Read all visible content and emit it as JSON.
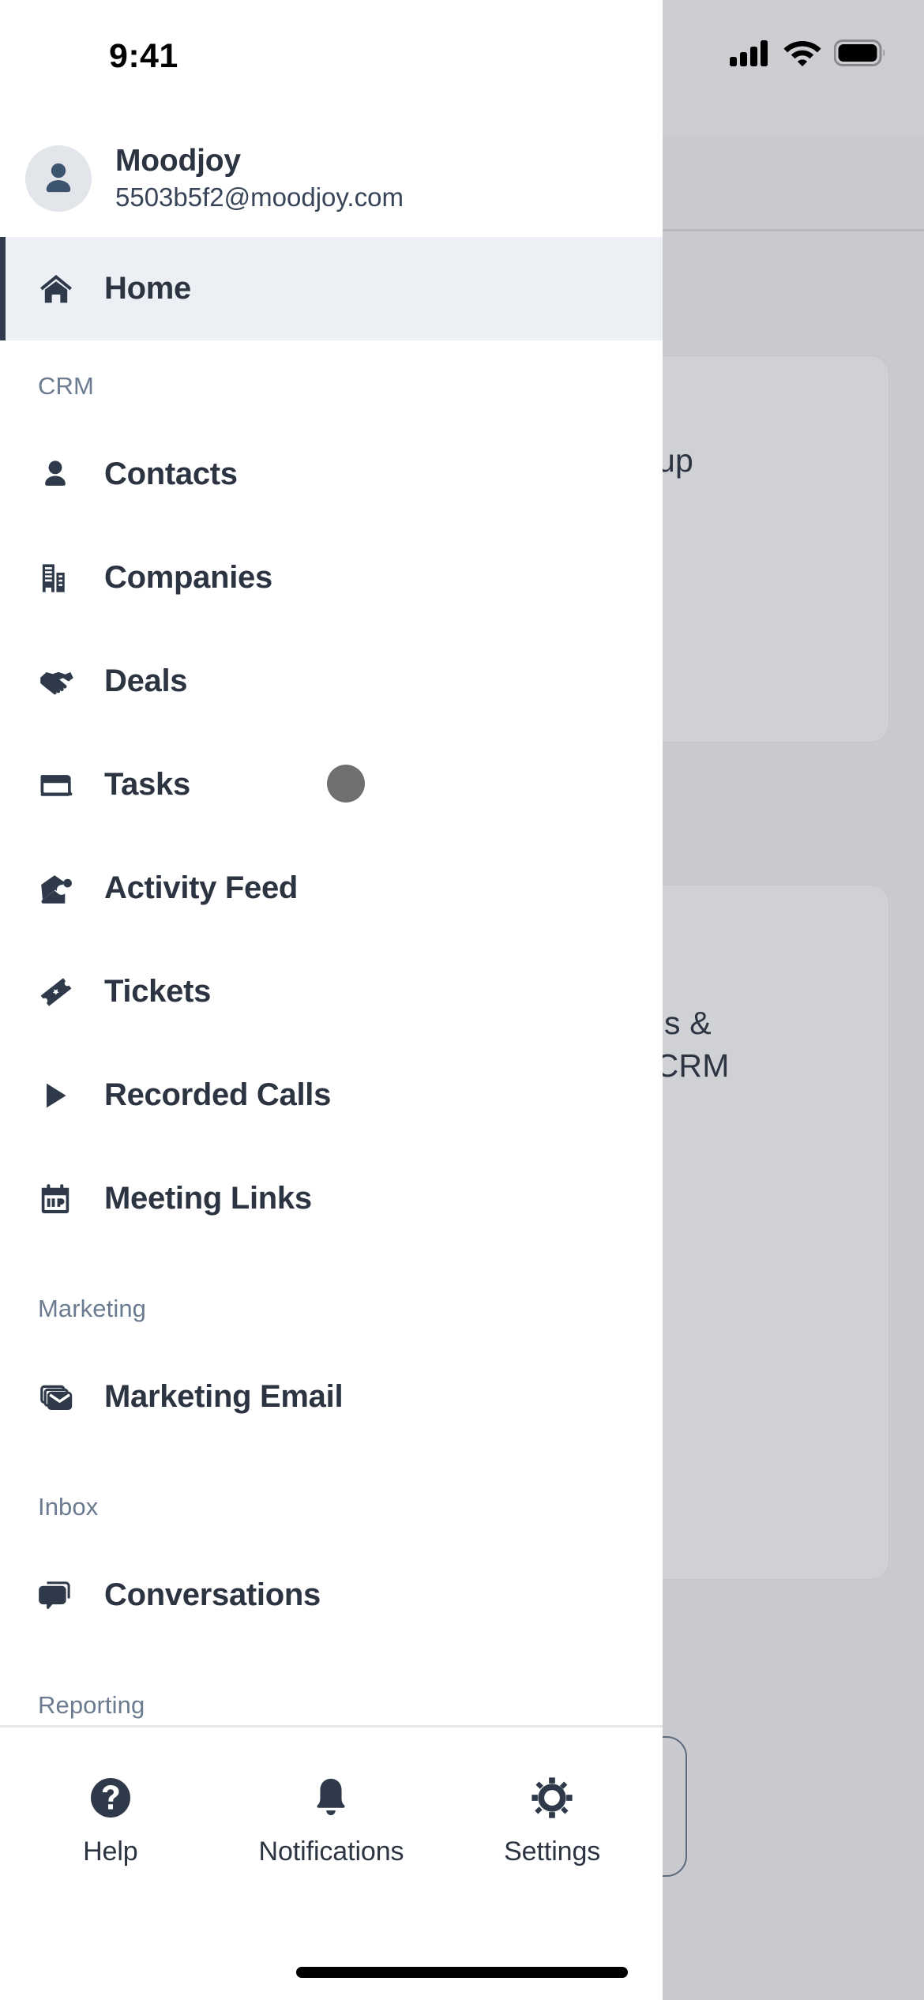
{
  "status_bar": {
    "time": "9:41",
    "icons": [
      "cellular-signal-icon",
      "wifi-icon",
      "battery-icon"
    ],
    "battery_full": true,
    "signal_bars": 4
  },
  "colors": {
    "text_primary": "#2c3442",
    "text_muted": "#6b7b90",
    "icon": "#2e3a4a",
    "active_row_bg": "#eceff3",
    "active_accent": "#2f3b4d",
    "drawer_bg": "#ffffff",
    "scrim": "#c9cacf",
    "avatar_bg": "#e2e5ea",
    "touch_indicator": "#706f71"
  },
  "profile": {
    "name": "Moodjoy",
    "email": "5503b5f2@moodjoy.com",
    "avatar_icon": "user-avatar-icon"
  },
  "nav": {
    "home": {
      "label": "Home",
      "icon": "home-icon",
      "active": true
    },
    "sections": [
      {
        "title": "CRM",
        "items": [
          {
            "label": "Contacts",
            "icon": "person-icon"
          },
          {
            "label": "Companies",
            "icon": "building-icon"
          },
          {
            "label": "Deals",
            "icon": "handshake-icon"
          },
          {
            "label": "Tasks",
            "icon": "notebook-icon"
          },
          {
            "label": "Activity Feed",
            "icon": "open-envelope-icon"
          },
          {
            "label": "Tickets",
            "icon": "ticket-icon"
          },
          {
            "label": "Recorded Calls",
            "icon": "play-icon"
          },
          {
            "label": "Meeting Links",
            "icon": "calendar-icon"
          }
        ]
      },
      {
        "title": "Marketing",
        "items": [
          {
            "label": "Marketing Email",
            "icon": "stacked-envelope-icon"
          }
        ]
      },
      {
        "title": "Inbox",
        "items": [
          {
            "label": "Conversations",
            "icon": "chat-bubble-icon"
          }
        ]
      },
      {
        "title": "Reporting",
        "items": []
      }
    ]
  },
  "bottom_bar": {
    "items": [
      {
        "label": "Help",
        "icon": "question-circle-icon"
      },
      {
        "label": "Notifications",
        "icon": "bell-icon"
      },
      {
        "label": "Settings",
        "icon": "gear-icon"
      }
    ]
  },
  "background_app": {
    "card_one_text": "up",
    "card_two_text": "gs &\n CRM"
  }
}
